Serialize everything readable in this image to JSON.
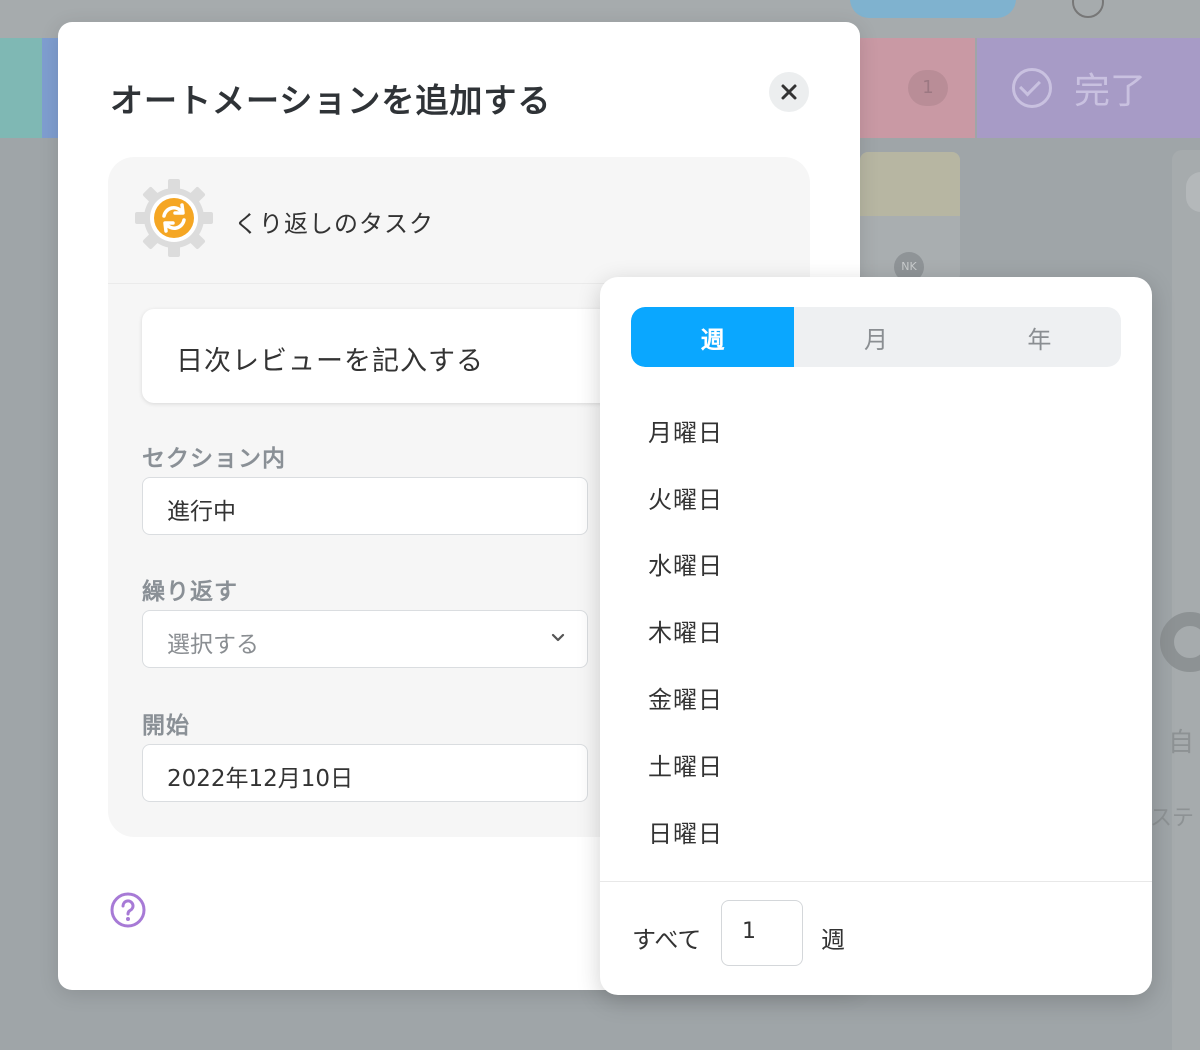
{
  "background": {
    "count_badge": "1",
    "done_column": "完了",
    "avatar_initials": "NK",
    "right_panel_title_fragment": "自",
    "right_panel_text_fragment": "ステ"
  },
  "modal": {
    "title": "オートメーションを追加する",
    "close_icon": "close-icon",
    "automation_type": "くり返しのタスク",
    "task_name": "日次レビューを記入する",
    "section_label": "セクション内",
    "section_value": "進行中",
    "repeat_label": "繰り返す",
    "repeat_placeholder": "選択する",
    "start_label": "開始",
    "start_value": "2022年12月10日",
    "help_icon": "help-icon"
  },
  "popover": {
    "tabs": [
      {
        "label": "週",
        "active": true
      },
      {
        "label": "月",
        "active": false
      },
      {
        "label": "年",
        "active": false
      }
    ],
    "days": [
      "月曜日",
      "火曜日",
      "水曜日",
      "木曜日",
      "金曜日",
      "土曜日",
      "日曜日"
    ],
    "footer": {
      "prefix": "すべて",
      "interval": "1",
      "unit": "週"
    }
  },
  "colors": {
    "accent": "#0aa7ff",
    "gear_orange": "#f5a623",
    "help_purple": "#a77ad6"
  }
}
